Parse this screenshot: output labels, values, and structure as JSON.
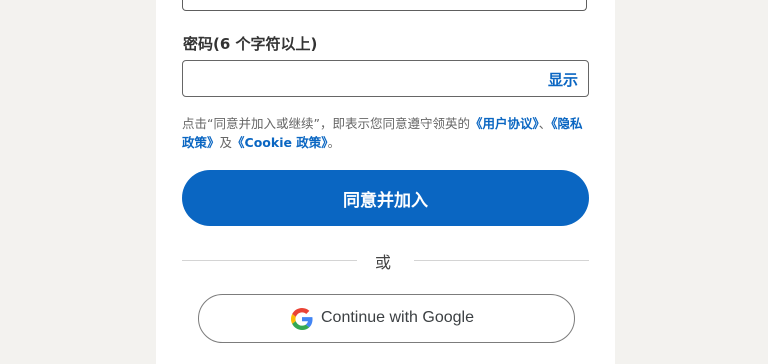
{
  "password": {
    "label": "密码(6 个字符以上)",
    "value": "",
    "show_label": "显示"
  },
  "legal": {
    "prefix": "点击“同意并加入或继续”，即表示您同意遵守领英的",
    "user_agreement": "《用户协议》",
    "sep1": "、",
    "privacy_policy": "《隐私政策》",
    "sep2": "及",
    "cookie_policy": "《Cookie 政策》",
    "suffix": "。"
  },
  "join_button": "同意并加入",
  "divider_text": "或",
  "google_button": "Continue with Google",
  "colors": {
    "primary": "#0a66c2",
    "google_blue": "#4285F4",
    "google_red": "#EA4335",
    "google_yellow": "#FBBC05",
    "google_green": "#34A853"
  }
}
